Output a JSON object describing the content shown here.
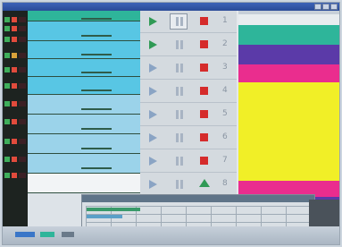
{
  "colors": {
    "accent_green": "#2f9a55",
    "stop_red": "#d52b2b",
    "cue_cyan": "#58c6e4",
    "cue_blue": "#9bd3ea",
    "magenta": "#ea2d8e",
    "yellow": "#f1ef27",
    "violet": "#5b3aa8",
    "teal": "#2eb59a"
  },
  "icons": {
    "play": "play-icon",
    "pause": "pause-icon",
    "stop": "stop-icon",
    "go": "go-icon"
  },
  "transport": {
    "rows": [
      {
        "number": "1",
        "active": true,
        "stop": "stop"
      },
      {
        "number": "2",
        "active": true,
        "stop": "stop"
      },
      {
        "number": "3",
        "active": false,
        "stop": "stop"
      },
      {
        "number": "4",
        "active": false,
        "stop": "stop"
      },
      {
        "number": "5",
        "active": false,
        "stop": "stop"
      },
      {
        "number": "6",
        "active": false,
        "stop": "stop"
      },
      {
        "number": "7",
        "active": false,
        "stop": "stop"
      },
      {
        "number": "8",
        "active": false,
        "stop": "go"
      }
    ]
  }
}
